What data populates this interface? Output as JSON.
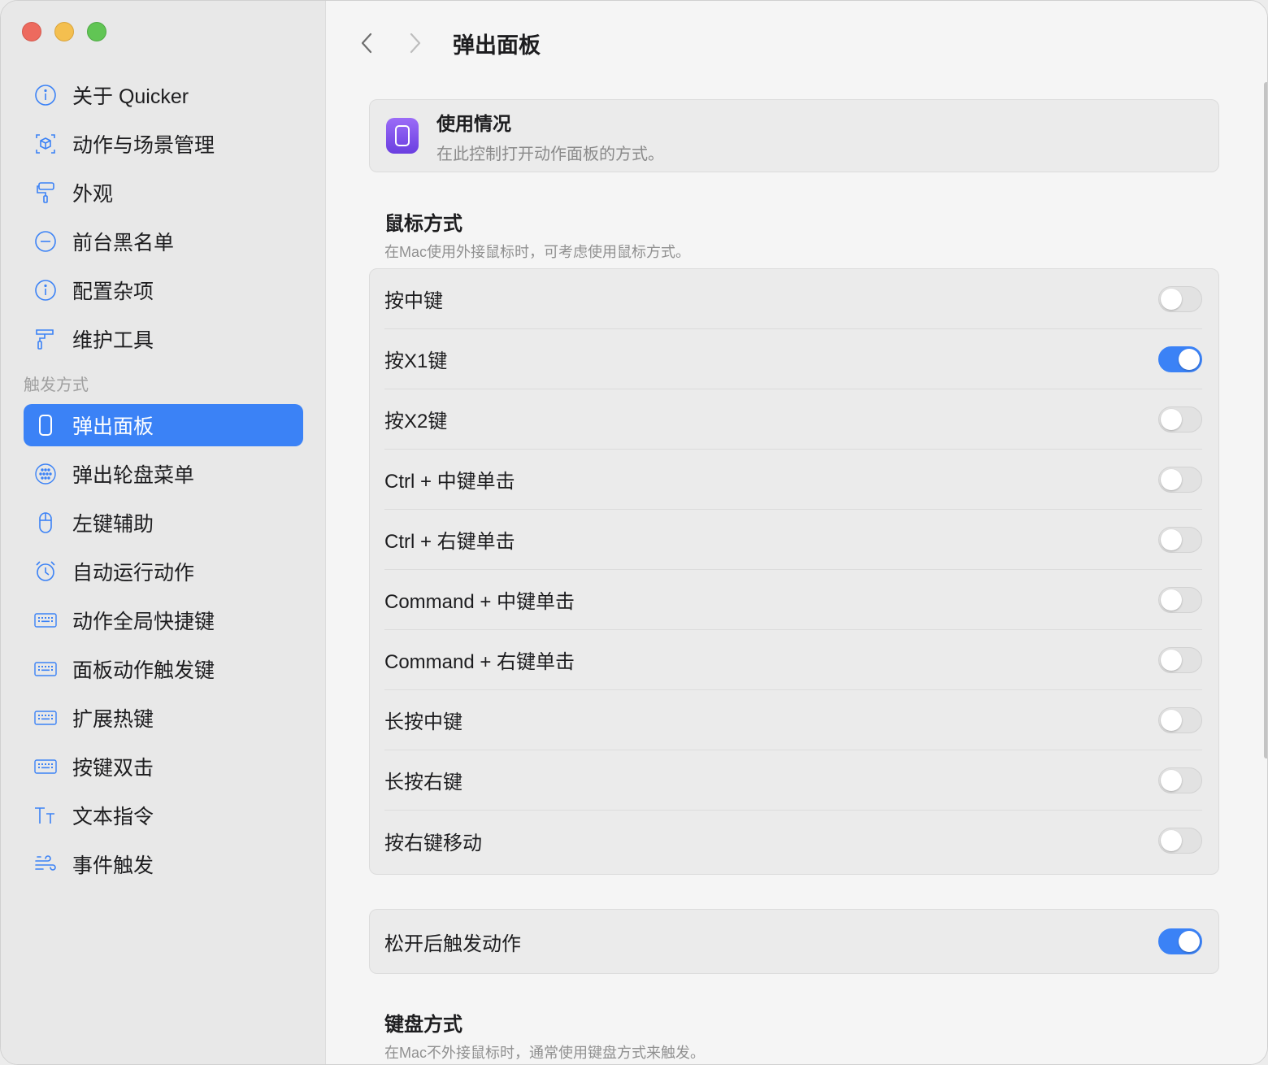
{
  "sidebar": {
    "items_top": [
      {
        "label": "关于 Quicker",
        "icon": "info-icon"
      },
      {
        "label": "动作与场景管理",
        "icon": "cube-icon"
      },
      {
        "label": "外观",
        "icon": "paintbrush-icon"
      },
      {
        "label": "前台黑名单",
        "icon": "minus-circle-icon"
      },
      {
        "label": "配置杂项",
        "icon": "info-icon"
      },
      {
        "label": "维护工具",
        "icon": "paint-roller-icon"
      }
    ],
    "section_label": "触发方式",
    "items_trigger": [
      {
        "label": "弹出面板",
        "icon": "panel-icon",
        "active": true
      },
      {
        "label": "弹出轮盘菜单",
        "icon": "wheel-icon"
      },
      {
        "label": "左键辅助",
        "icon": "mouse-icon"
      },
      {
        "label": "自动运行动作",
        "icon": "alarm-icon"
      },
      {
        "label": "动作全局快捷键",
        "icon": "keyboard-icon"
      },
      {
        "label": "面板动作触发键",
        "icon": "keyboard-icon"
      },
      {
        "label": "扩展热键",
        "icon": "keyboard-icon"
      },
      {
        "label": "按键双击",
        "icon": "keyboard-icon"
      },
      {
        "label": "文本指令",
        "icon": "text-size-icon"
      },
      {
        "label": "事件触发",
        "icon": "wind-icon"
      }
    ]
  },
  "main": {
    "title": "弹出面板",
    "usage": {
      "title": "使用情况",
      "desc": "在此控制打开动作面板的方式。"
    },
    "mouse_section": {
      "heading": "鼠标方式",
      "desc": "在Mac使用外接鼠标时，可考虑使用鼠标方式。"
    },
    "mouse_options": [
      {
        "label": "按中键",
        "on": false
      },
      {
        "label": "按X1键",
        "on": true
      },
      {
        "label": "按X2键",
        "on": false
      },
      {
        "label": "Ctrl + 中键单击",
        "on": false
      },
      {
        "label": "Ctrl + 右键单击",
        "on": false
      },
      {
        "label": "Command + 中键单击",
        "on": false
      },
      {
        "label": "Command + 右键单击",
        "on": false
      },
      {
        "label": "长按中键",
        "on": false
      },
      {
        "label": "长按右键",
        "on": false
      },
      {
        "label": "按右键移动",
        "on": false
      }
    ],
    "release": {
      "label": "松开后触发动作",
      "on": true
    },
    "keyboard_section": {
      "heading": "键盘方式",
      "desc": "在Mac不外接鼠标时，通常使用键盘方式来触发。"
    }
  },
  "colors": {
    "accent": "#3b82f6",
    "sidebar_bg": "#e8e8e8",
    "content_bg": "#f5f5f5",
    "usage_icon": "#7c4dee"
  }
}
